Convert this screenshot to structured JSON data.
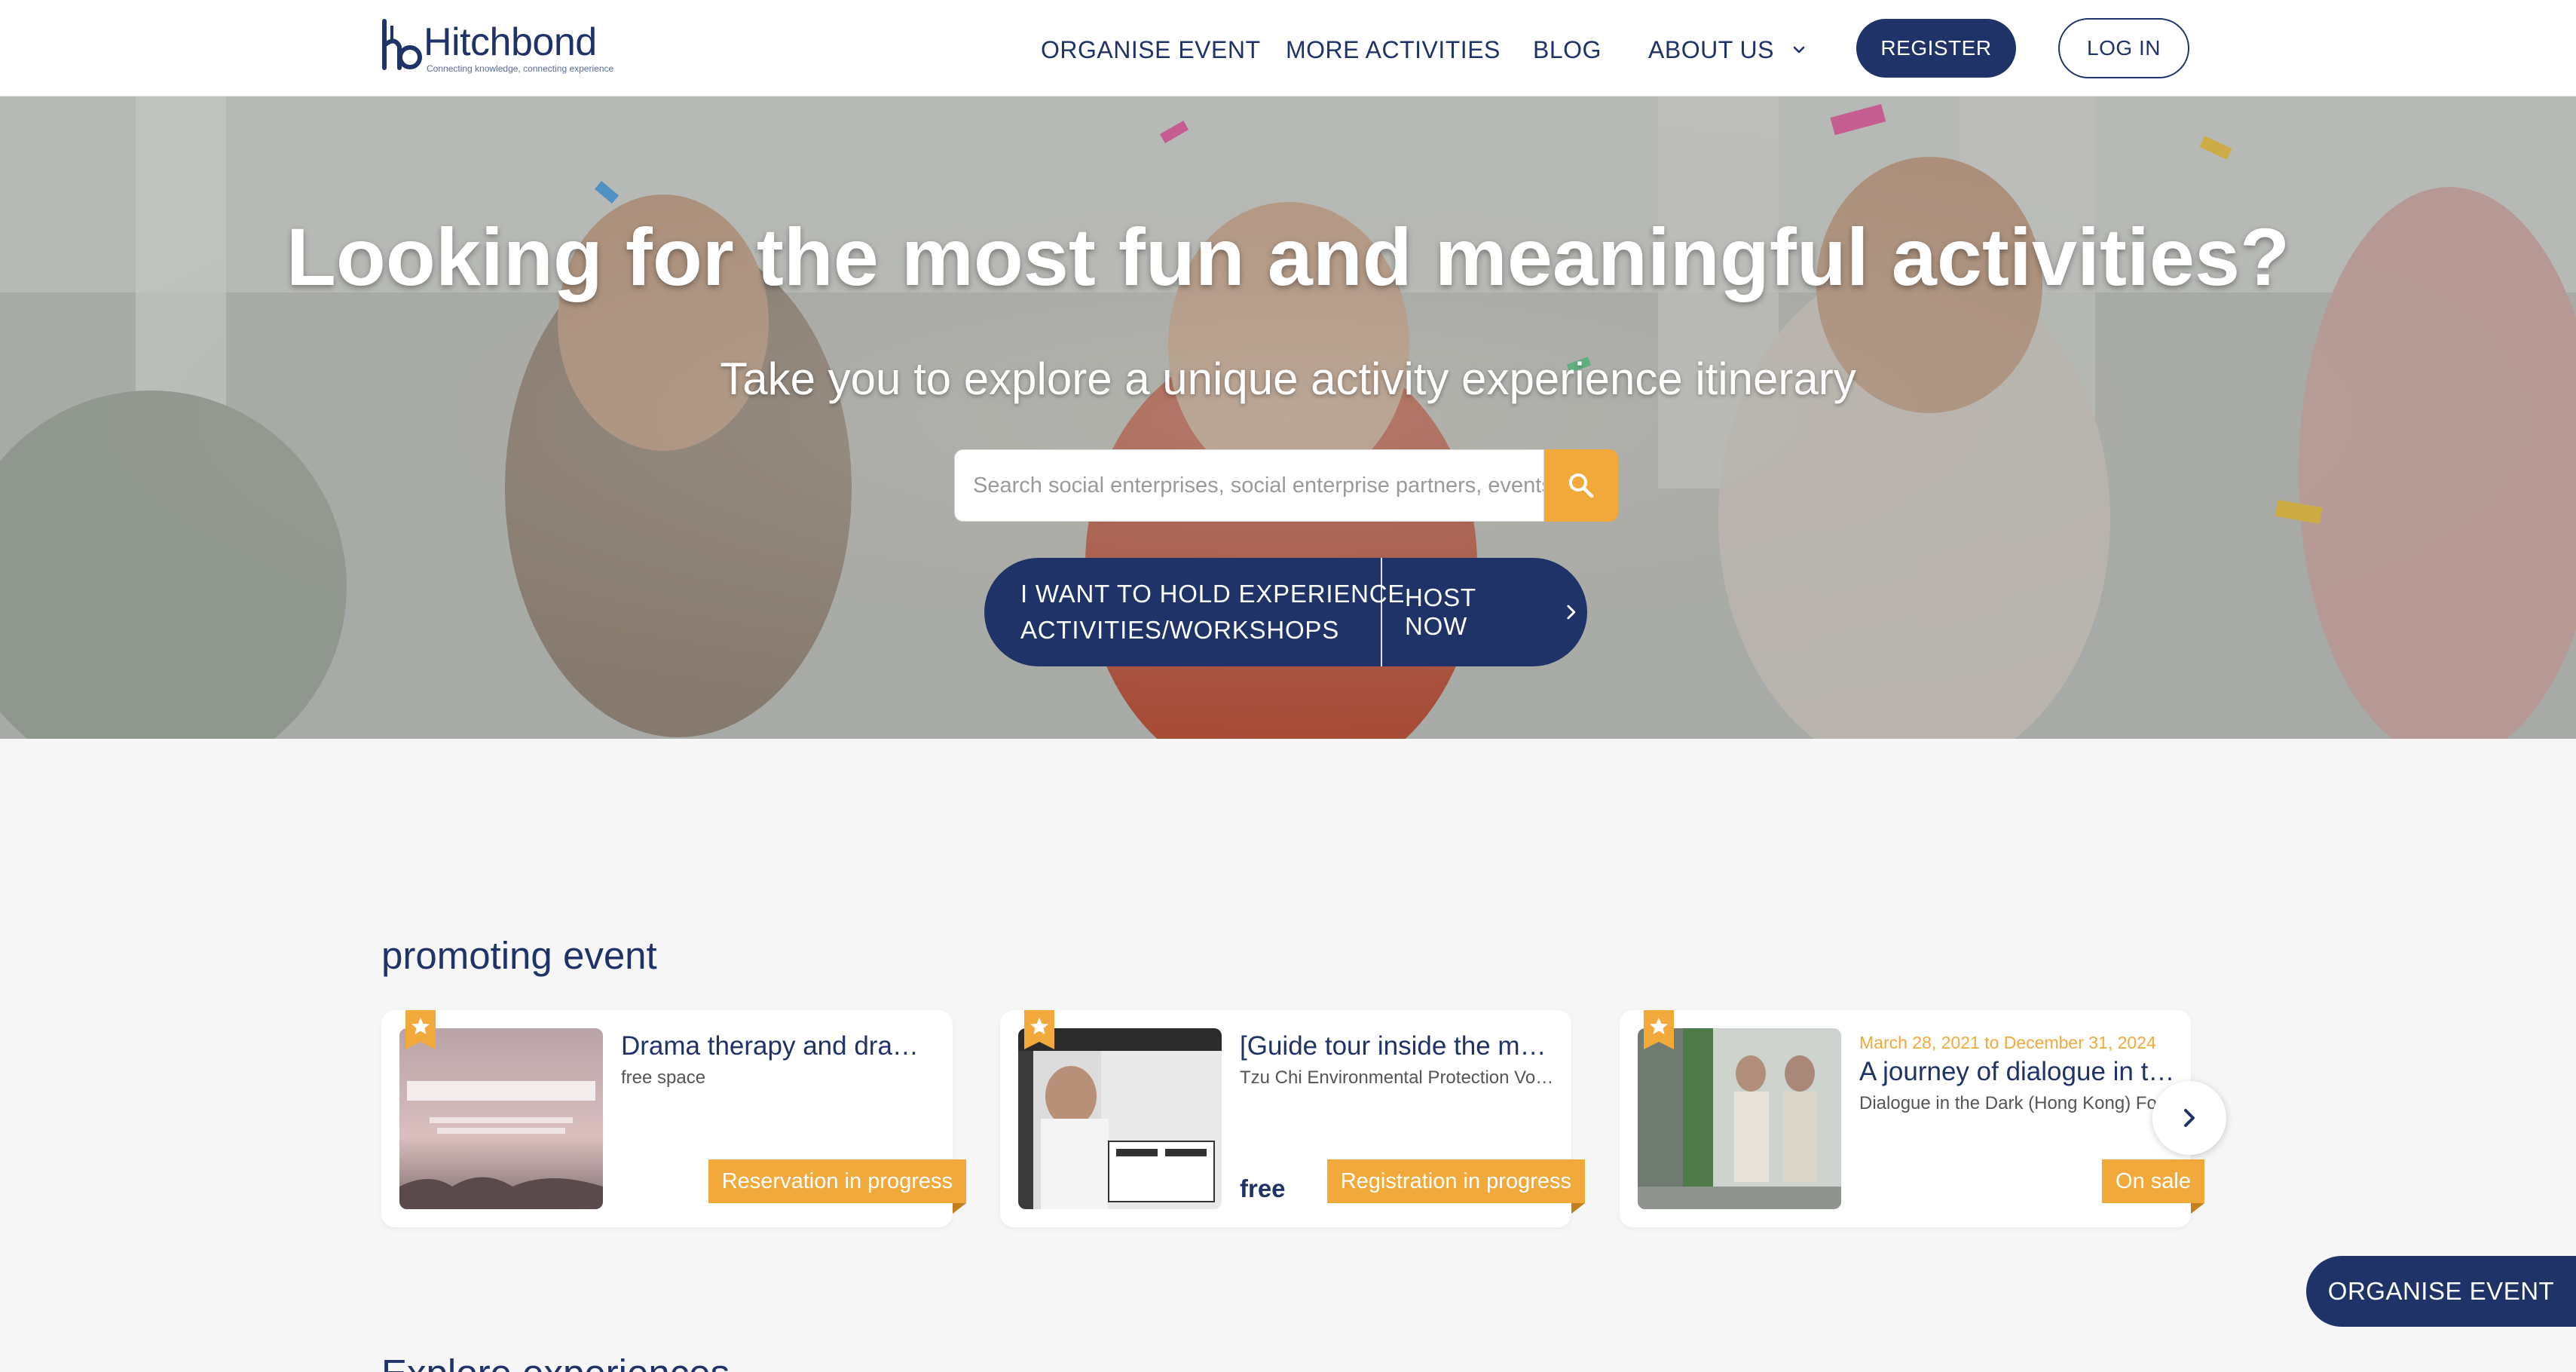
{
  "brand": {
    "name": "Hitchbond",
    "tagline": "Connecting knowledge, connecting experience",
    "primary_color": "#1f3368",
    "accent_color": "#f2a93b"
  },
  "nav": {
    "items": [
      {
        "label": "ORGANISE EVENT"
      },
      {
        "label": "MORE ACTIVITIES"
      },
      {
        "label": "BLOG"
      },
      {
        "label": "ABOUT US",
        "icon": "chevron-down-icon"
      }
    ],
    "register": "REGISTER",
    "login": "LOG IN"
  },
  "hero": {
    "title": "Looking for the most fun and meaningful activities?",
    "subtitle": "Take you to explore a unique activity experience itinerary",
    "search": {
      "placeholder": "Search social enterprises, social enterprise partners, events",
      "value": "",
      "icon": "search-icon"
    },
    "host_cta": {
      "line1": "I WANT TO HOLD EXPERIENCE",
      "line2": "ACTIVITIES/WORKSHOPS",
      "action": "HOST NOW",
      "icon": "chevron-right-icon"
    }
  },
  "promoting": {
    "title": "promoting event",
    "cards": [
      {
        "title": "Drama therapy and drama therapy workshop",
        "org": "free space",
        "date": "",
        "price": "",
        "status": "Reservation in progress"
      },
      {
        "title": "[Guide tour inside the museum] Tzu Chi",
        "org": "Tzu Chi Environmental Protection Volunteers",
        "date": "",
        "price": "free",
        "status": "Registration in progress"
      },
      {
        "title": "A journey of dialogue in the dark",
        "org": "Dialogue in the Dark (Hong Kong) Foundation",
        "date": "March 28, 2021 to December 31, 2024",
        "price": "",
        "status": "On sale"
      }
    ],
    "next_icon": "chevron-right-icon"
  },
  "explore": {
    "title": "Explore experiences"
  },
  "floating": {
    "organise": "ORGANISE EVENT"
  }
}
